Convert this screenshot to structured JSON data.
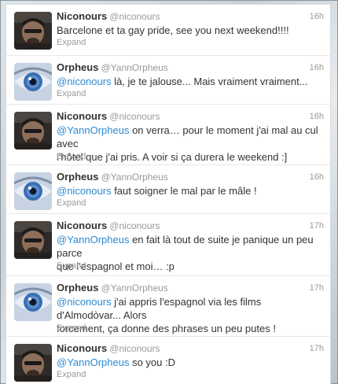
{
  "colors": {
    "link": "#2a8ad4",
    "muted": "#999999",
    "text": "#333333"
  },
  "tweets": [
    {
      "avatar": "niconours-avatar",
      "fullname": "Niconours",
      "username": "@niconours",
      "time": "16h",
      "mention": "",
      "text_line1": "Barcelone et ta gay pride, see you next weekend!!!!",
      "text_line2": "",
      "expand": "Expand"
    },
    {
      "avatar": "orpheus-eye-avatar",
      "fullname": "Orpheus",
      "username": "@YannOrpheus",
      "time": "16h",
      "mention": "@niconours",
      "text_line1": " là, je te jalouse... Mais vraiment vraiment...",
      "text_line2": "",
      "expand": "Expand"
    },
    {
      "avatar": "niconours-avatar",
      "fullname": "Niconours",
      "username": "@niconours",
      "time": "16h",
      "mention": "@YannOrpheus",
      "text_line1": " on verra… pour le moment j'ai mal au cul avec",
      "text_line2": "l'hôtel que j'ai pris. A voir si ça durera le weekend :]",
      "expand": "Expand"
    },
    {
      "avatar": "orpheus-eye-avatar",
      "fullname": "Orpheus",
      "username": "@YannOrpheus",
      "time": "16h",
      "mention": "@niconours",
      "text_line1": " faut soigner le mal par le mâle !",
      "text_line2": "",
      "expand": "Expand"
    },
    {
      "avatar": "niconours-avatar",
      "fullname": "Niconours",
      "username": "@niconours",
      "time": "17h",
      "mention": "@YannOrpheus",
      "text_line1": " en fait là tout de suite je panique un peu parce",
      "text_line2": "que l'espagnol et moi… :p",
      "expand": "Expand"
    },
    {
      "avatar": "orpheus-eye-avatar",
      "fullname": "Orpheus",
      "username": "@YannOrpheus",
      "time": "17h",
      "mention": "@niconours",
      "text_line1": " j'ai appris l'espagnol via les films d'Almodòvar... Alors",
      "text_line2": "forcement, ça donne des phrases un peu putes !",
      "expand": "Expand"
    },
    {
      "avatar": "niconours-avatar",
      "fullname": "Niconours",
      "username": "@niconours",
      "time": "17h",
      "mention": "@YannOrpheus",
      "text_line1": " so you :D",
      "text_line2": "",
      "expand": "Expand"
    }
  ]
}
